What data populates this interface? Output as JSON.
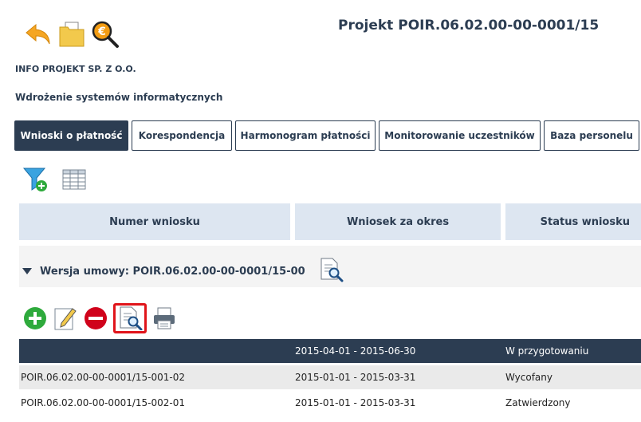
{
  "header": {
    "project_title": "Projekt POIR.06.02.00-00-0001/15",
    "company": "INFO PROJEKT SP. Z O.O.",
    "subtitle": "Wdrożenie systemów informatycznych"
  },
  "tabs": [
    {
      "label": "Wnioski o płatność",
      "active": true
    },
    {
      "label": "Korespondencja",
      "active": false
    },
    {
      "label": "Harmonogram płatności",
      "active": false
    },
    {
      "label": "Monitorowanie uczestników",
      "active": false
    },
    {
      "label": "Baza personelu",
      "active": false
    }
  ],
  "table": {
    "columns": [
      "Numer wniosku",
      "Wniosek za okres",
      "Status wniosku"
    ],
    "group_label": "Wersja umowy: POIR.06.02.00-00-0001/15-00",
    "rows": [
      {
        "number": "",
        "period": "2015-04-01 - 2015-06-30",
        "status": "W przygotowaniu"
      },
      {
        "number": "POIR.06.02.00-00-0001/15-001-02",
        "period": "2015-01-01 - 2015-03-31",
        "status": "Wycofany"
      },
      {
        "number": "POIR.06.02.00-00-0001/15-002-01",
        "period": "2015-01-01 - 2015-03-31",
        "status": "Zatwierdzony"
      }
    ]
  },
  "colors": {
    "primary": "#2c3d52",
    "header_bg": "#dde6f1",
    "highlight": "#e0141a"
  }
}
